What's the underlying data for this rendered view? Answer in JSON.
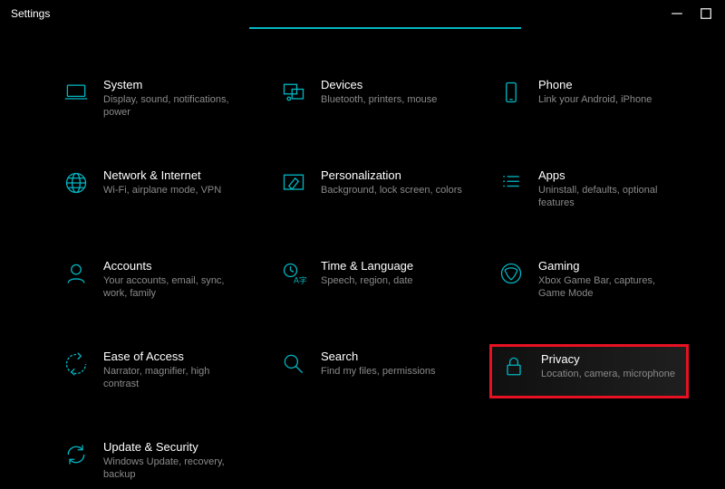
{
  "window": {
    "title": "Settings"
  },
  "accent_color": "#00b7c3",
  "highlight_color": "#e81123",
  "tiles": [
    {
      "icon": "laptop-icon",
      "title": "System",
      "desc": "Display, sound, notifications, power"
    },
    {
      "icon": "devices-icon",
      "title": "Devices",
      "desc": "Bluetooth, printers, mouse"
    },
    {
      "icon": "phone-icon",
      "title": "Phone",
      "desc": "Link your Android, iPhone"
    },
    {
      "icon": "globe-icon",
      "title": "Network & Internet",
      "desc": "Wi-Fi, airplane mode, VPN"
    },
    {
      "icon": "brush-icon",
      "title": "Personalization",
      "desc": "Background, lock screen, colors"
    },
    {
      "icon": "apps-icon",
      "title": "Apps",
      "desc": "Uninstall, defaults, optional features"
    },
    {
      "icon": "person-icon",
      "title": "Accounts",
      "desc": "Your accounts, email, sync, work, family"
    },
    {
      "icon": "time-lang-icon",
      "title": "Time & Language",
      "desc": "Speech, region, date"
    },
    {
      "icon": "gaming-icon",
      "title": "Gaming",
      "desc": "Xbox Game Bar, captures, Game Mode"
    },
    {
      "icon": "ease-icon",
      "title": "Ease of Access",
      "desc": "Narrator, magnifier, high contrast"
    },
    {
      "icon": "search-icon",
      "title": "Search",
      "desc": "Find my files, permissions"
    },
    {
      "icon": "lock-icon",
      "title": "Privacy",
      "desc": "Location, camera, microphone",
      "highlighted": true
    },
    {
      "icon": "update-icon",
      "title": "Update & Security",
      "desc": "Windows Update, recovery, backup"
    }
  ]
}
